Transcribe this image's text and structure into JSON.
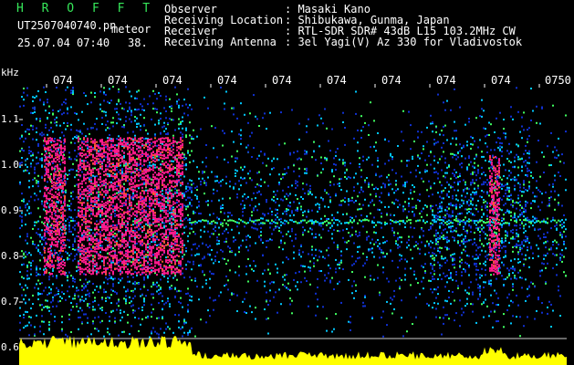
{
  "header": {
    "program": "H R O F F T",
    "filename": "UT2507040740.pn",
    "tag": "meteor",
    "datetime": "25.07.04 07:40",
    "seconds": "38.",
    "info": [
      {
        "label": "Observer",
        "value": ": Masaki Kano"
      },
      {
        "label": "Receiving Location",
        "value": ": Shibukawa, Gunma, Japan"
      },
      {
        "label": "Receiver",
        "value": ": RTL-SDR SDR# 43dB L15 103.2MHz CW"
      },
      {
        "label": "Receiving Antenna",
        "value": ": 3el Yagi(V) Az 330 for Vladivostok"
      }
    ]
  },
  "axes": {
    "y_unit": "kHz",
    "y_ticks": [
      "1.1",
      "1.0",
      "0.9",
      "0.8",
      "0.7",
      "0.6"
    ],
    "x_ticks": [
      "074",
      "074",
      "074",
      "074",
      "074",
      "074",
      "074",
      "074",
      "074",
      "0750"
    ]
  },
  "colors": {
    "background": "#000000",
    "label_text": "#ffffff",
    "program_title": "#36e85a",
    "power_trace": "#ffff00",
    "meteor_echo": "#ff1a8c",
    "noise_low": "#1030d0",
    "noise_mid": "#00c8ff",
    "noise_high": "#40ff60"
  }
}
